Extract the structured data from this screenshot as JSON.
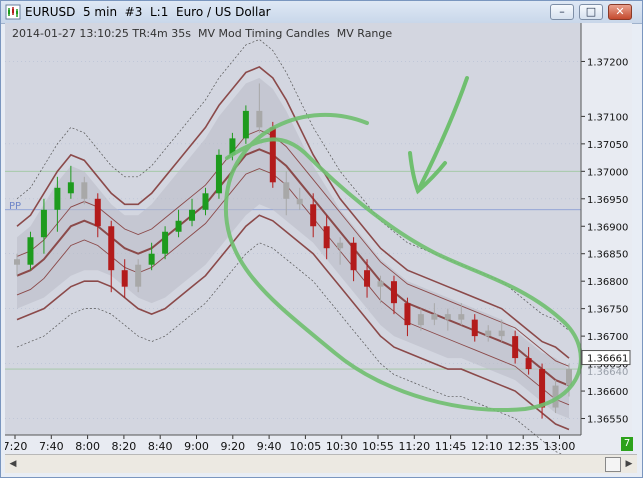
{
  "window": {
    "title": "EURUSD  5 min  #3  L:1  Euro / US Dollar",
    "minimize_label": "–",
    "maximize_label": "□",
    "close_label": "✕"
  },
  "chart": {
    "info_line": "2014-01-27 13:10:25 TR:4m 35s  MV Mod Timing Candles  MV Range",
    "pp_label": "PP",
    "corner_badge": "7",
    "current_price": "1.36661",
    "previous_price": "1.36640",
    "colors": {
      "background": "#d3d6e0",
      "bull": "#1e9b1e",
      "bear": "#b31b1b",
      "neutral": "#a8a8a8",
      "ma": "#8b4a4a",
      "annotation": "#6fbf6f",
      "band": "#b9bcc6"
    }
  },
  "chart_data": {
    "type": "candlestick",
    "y_ticks": [
      "1.37200",
      "1.37100",
      "1.37050",
      "1.37000",
      "1.36950",
      "1.36900",
      "1.36850",
      "1.36800",
      "1.36750",
      "1.36700",
      "1.36650",
      "1.36600",
      "1.36550"
    ],
    "y_tick_values": [
      1.372,
      1.371,
      1.3705,
      1.37,
      1.3695,
      1.369,
      1.3685,
      1.368,
      1.3675,
      1.367,
      1.3665,
      1.366,
      1.3655
    ],
    "x_ticks": [
      "7:20",
      "7:40",
      "8:00",
      "8:20",
      "8:40",
      "9:00",
      "9:20",
      "9:40",
      "10:05",
      "10:30",
      "10:55",
      "11:20",
      "11:45",
      "12:10",
      "12:35",
      "13:00"
    ],
    "ylim": [
      1.3652,
      1.3727
    ],
    "candles": [
      {
        "o": 1.3683,
        "h": 1.3685,
        "l": 1.3681,
        "c": 1.3684,
        "k": "n"
      },
      {
        "o": 1.3683,
        "h": 1.3689,
        "l": 1.3682,
        "c": 1.3688,
        "k": "g"
      },
      {
        "o": 1.3688,
        "h": 1.3695,
        "l": 1.3685,
        "c": 1.3693,
        "k": "g"
      },
      {
        "o": 1.3693,
        "h": 1.3699,
        "l": 1.3689,
        "c": 1.3697,
        "k": "g"
      },
      {
        "o": 1.3696,
        "h": 1.3701,
        "l": 1.3695,
        "c": 1.3698,
        "k": "g"
      },
      {
        "o": 1.3698,
        "h": 1.3699,
        "l": 1.3694,
        "c": 1.3695,
        "k": "n"
      },
      {
        "o": 1.3695,
        "h": 1.3696,
        "l": 1.3688,
        "c": 1.369,
        "k": "r"
      },
      {
        "o": 1.369,
        "h": 1.3691,
        "l": 1.3678,
        "c": 1.3682,
        "k": "r"
      },
      {
        "o": 1.3682,
        "h": 1.3684,
        "l": 1.3677,
        "c": 1.3679,
        "k": "r"
      },
      {
        "o": 1.3679,
        "h": 1.3684,
        "l": 1.3678,
        "c": 1.3683,
        "k": "n"
      },
      {
        "o": 1.3683,
        "h": 1.3687,
        "l": 1.3682,
        "c": 1.3685,
        "k": "g"
      },
      {
        "o": 1.3685,
        "h": 1.369,
        "l": 1.3684,
        "c": 1.3689,
        "k": "g"
      },
      {
        "o": 1.3689,
        "h": 1.3693,
        "l": 1.3688,
        "c": 1.3691,
        "k": "g"
      },
      {
        "o": 1.3691,
        "h": 1.3695,
        "l": 1.369,
        "c": 1.3693,
        "k": "g"
      },
      {
        "o": 1.3693,
        "h": 1.3697,
        "l": 1.3692,
        "c": 1.3696,
        "k": "g"
      },
      {
        "o": 1.3696,
        "h": 1.3704,
        "l": 1.3695,
        "c": 1.3703,
        "k": "g"
      },
      {
        "o": 1.3703,
        "h": 1.3707,
        "l": 1.3702,
        "c": 1.3706,
        "k": "g"
      },
      {
        "o": 1.3706,
        "h": 1.3712,
        "l": 1.3705,
        "c": 1.3711,
        "k": "g"
      },
      {
        "o": 1.3711,
        "h": 1.3716,
        "l": 1.3707,
        "c": 1.3708,
        "k": "n"
      },
      {
        "o": 1.3708,
        "h": 1.3709,
        "l": 1.3697,
        "c": 1.3698,
        "k": "r"
      },
      {
        "o": 1.3698,
        "h": 1.37,
        "l": 1.3692,
        "c": 1.3695,
        "k": "n"
      },
      {
        "o": 1.3695,
        "h": 1.3697,
        "l": 1.3693,
        "c": 1.3694,
        "k": "n"
      },
      {
        "o": 1.3694,
        "h": 1.3696,
        "l": 1.3688,
        "c": 1.369,
        "k": "r"
      },
      {
        "o": 1.369,
        "h": 1.3692,
        "l": 1.3684,
        "c": 1.3686,
        "k": "r"
      },
      {
        "o": 1.3686,
        "h": 1.3688,
        "l": 1.3683,
        "c": 1.3687,
        "k": "n"
      },
      {
        "o": 1.3687,
        "h": 1.3688,
        "l": 1.368,
        "c": 1.3682,
        "k": "r"
      },
      {
        "o": 1.3682,
        "h": 1.3684,
        "l": 1.3677,
        "c": 1.3679,
        "k": "r"
      },
      {
        "o": 1.3679,
        "h": 1.3681,
        "l": 1.3676,
        "c": 1.368,
        "k": "n"
      },
      {
        "o": 1.368,
        "h": 1.3681,
        "l": 1.3674,
        "c": 1.3676,
        "k": "r"
      },
      {
        "o": 1.3676,
        "h": 1.3677,
        "l": 1.367,
        "c": 1.3672,
        "k": "r"
      },
      {
        "o": 1.3672,
        "h": 1.3675,
        "l": 1.3671,
        "c": 1.3674,
        "k": "n"
      },
      {
        "o": 1.3674,
        "h": 1.3676,
        "l": 1.3672,
        "c": 1.3673,
        "k": "n"
      },
      {
        "o": 1.3673,
        "h": 1.3675,
        "l": 1.3671,
        "c": 1.3674,
        "k": "n"
      },
      {
        "o": 1.3674,
        "h": 1.3676,
        "l": 1.3672,
        "c": 1.3673,
        "k": "n"
      },
      {
        "o": 1.3673,
        "h": 1.3674,
        "l": 1.3669,
        "c": 1.367,
        "k": "r"
      },
      {
        "o": 1.367,
        "h": 1.3672,
        "l": 1.3669,
        "c": 1.3671,
        "k": "n"
      },
      {
        "o": 1.3671,
        "h": 1.3673,
        "l": 1.3669,
        "c": 1.367,
        "k": "n"
      },
      {
        "o": 1.367,
        "h": 1.3671,
        "l": 1.3665,
        "c": 1.3666,
        "k": "r"
      },
      {
        "o": 1.3666,
        "h": 1.3668,
        "l": 1.3663,
        "c": 1.3664,
        "k": "r"
      },
      {
        "o": 1.3664,
        "h": 1.3665,
        "l": 1.3655,
        "c": 1.3657,
        "k": "r"
      },
      {
        "o": 1.3657,
        "h": 1.3662,
        "l": 1.3656,
        "c": 1.3661,
        "k": "n"
      },
      {
        "o": 1.3661,
        "h": 1.3665,
        "l": 1.3659,
        "c": 1.3664,
        "k": "n"
      }
    ],
    "moving_average": [
      1.3681,
      1.3682,
      1.3684,
      1.3687,
      1.369,
      1.3691,
      1.369,
      1.3688,
      1.3686,
      1.3685,
      1.3686,
      1.3688,
      1.369,
      1.3692,
      1.3694,
      1.3697,
      1.37,
      1.3703,
      1.3704,
      1.3703,
      1.3701,
      1.3698,
      1.3695,
      1.3692,
      1.3689,
      1.3686,
      1.3683,
      1.368,
      1.3678,
      1.3676,
      1.3675,
      1.3674,
      1.3673,
      1.3672,
      1.3671,
      1.367,
      1.3669,
      1.3668,
      1.3666,
      1.3664,
      1.3662,
      1.3661
    ],
    "band_upper": [
      1.3688,
      1.369,
      1.3694,
      1.3698,
      1.3701,
      1.37,
      1.3697,
      1.3694,
      1.3692,
      1.3692,
      1.3694,
      1.3697,
      1.37,
      1.3703,
      1.3706,
      1.371,
      1.3713,
      1.3716,
      1.3717,
      1.3715,
      1.3711,
      1.3706,
      1.3701,
      1.3697,
      1.3693,
      1.369,
      1.3687,
      1.3684,
      1.3682,
      1.368,
      1.3679,
      1.3678,
      1.3677,
      1.3676,
      1.3675,
      1.3674,
      1.3673,
      1.3671,
      1.3669,
      1.3667,
      1.3666,
      1.3664
    ],
    "band_lower": [
      1.3675,
      1.3676,
      1.3677,
      1.3679,
      1.3681,
      1.3682,
      1.3682,
      1.3681,
      1.3679,
      1.3677,
      1.3676,
      1.3677,
      1.3679,
      1.3681,
      1.3683,
      1.3686,
      1.3689,
      1.3692,
      1.3694,
      1.3693,
      1.3691,
      1.3689,
      1.3687,
      1.3684,
      1.3681,
      1.3678,
      1.3675,
      1.3672,
      1.367,
      1.3669,
      1.3668,
      1.3667,
      1.3666,
      1.3666,
      1.3665,
      1.3664,
      1.3663,
      1.3662,
      1.366,
      1.3658,
      1.3656,
      1.3655
    ],
    "pp_level": 1.3693,
    "grid": false
  }
}
